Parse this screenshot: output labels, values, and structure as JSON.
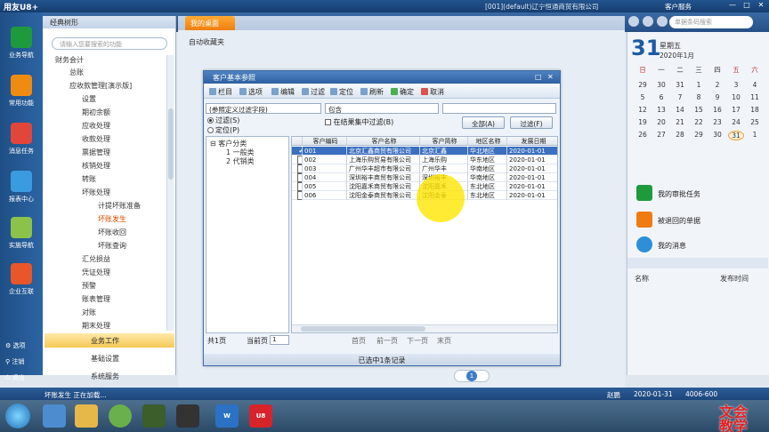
{
  "app": {
    "logo": "用友U8+",
    "account": "[001](default)辽宁恒通商贸有限公司",
    "service": "客户服务",
    "search_placeholder": "单据条码搜索",
    "min": "—",
    "restore": "□",
    "close": "✕"
  },
  "leftnav": [
    {
      "label": "业务导航",
      "color": "#1e9a3d"
    },
    {
      "label": "常用功能",
      "color": "#f08b12"
    },
    {
      "label": "消息任务",
      "color": "#e2463a"
    },
    {
      "label": "报表中心",
      "color": "#3b9be0"
    },
    {
      "label": "实施导航",
      "color": "#8bc34a"
    },
    {
      "label": "企业互联",
      "color": "#e8562a"
    }
  ],
  "leftbottom": [
    {
      "label": "选项"
    },
    {
      "label": "注销"
    },
    {
      "label": "退出"
    }
  ],
  "tree": {
    "header": "经典树形",
    "search_placeholder": "请输入您要搜索的功能",
    "items": [
      "财务会计",
      "总账",
      "应收款管理[演示版]",
      "设置",
      "期初余额",
      "应收处理",
      "收款处理",
      "票据管理",
      "核销处理",
      "转账",
      "坏账处理",
      "计提坏账准备",
      "坏账发生",
      "坏账收回",
      "坏账查询",
      "汇兑损益",
      "凭证处理",
      "预警",
      "账表管理",
      "对账",
      "期末处理"
    ],
    "tabs": [
      "业务工作",
      "基础设置",
      "系统服务"
    ]
  },
  "center": {
    "tab": "我的桌面",
    "favorites": "自动收藏夹"
  },
  "dialog": {
    "title": "客户基本参照",
    "toolbar": [
      "栏目",
      "选项",
      "编辑",
      "过滤",
      "定位",
      "刷新",
      "确定",
      "取消"
    ],
    "field": "(参照定义过滤字段)",
    "op": "包含",
    "radio1": "过滤(S)",
    "radio2": "定位(P)",
    "checkbox": "在结果集中过滤(B)",
    "btn_all": "全部(A)",
    "btn_filter": "过滤(F)",
    "tree": [
      "客户分类",
      "1 一般类",
      "2 代销类"
    ],
    "columns": [
      "客户编码",
      "客户名称",
      "客户简称",
      "地区名称",
      "发展日期"
    ],
    "rows": [
      [
        "001",
        "北京汇鑫商贸有限公司",
        "北京汇鑫",
        "华北地区",
        "2020-01-01"
      ],
      [
        "002",
        "上海乐购贸易有限公司",
        "上海乐购",
        "华东地区",
        "2020-01-01"
      ],
      [
        "003",
        "广州华丰超市有限公司",
        "广州华丰",
        "华南地区",
        "2020-01-01"
      ],
      [
        "004",
        "深圳裕丰商贸有限公司",
        "深圳裕丰",
        "华南地区",
        "2020-01-01"
      ],
      [
        "005",
        "沈阳嘉禾商贸有限公司",
        "沈阳嘉禾",
        "东北地区",
        "2020-01-01"
      ],
      [
        "006",
        "沈阳金泰商贸有限公司",
        "沈阳金泰",
        "东北地区",
        "2020-01-01"
      ]
    ],
    "check_mark": "✔",
    "pager": {
      "total": "共1页",
      "current_label": "当前页",
      "current": "1",
      "first": "首页",
      "prev": "前一页",
      "next": "下一页",
      "last": "末页"
    },
    "status": "已选中1条记录"
  },
  "calendar": {
    "day": "31",
    "weekday": "星期五",
    "month": "2020年1月",
    "headers": [
      "日",
      "一",
      "二",
      "三",
      "四",
      "五",
      "六"
    ],
    "weeks": [
      [
        "29",
        "30",
        "31",
        "1",
        "2",
        "3",
        "4"
      ],
      [
        "5",
        "6",
        "7",
        "8",
        "9",
        "10",
        "11"
      ],
      [
        "12",
        "13",
        "14",
        "15",
        "16",
        "17",
        "18"
      ],
      [
        "19",
        "20",
        "21",
        "22",
        "23",
        "24",
        "25"
      ],
      [
        "26",
        "27",
        "28",
        "29",
        "30",
        "31",
        "1"
      ]
    ]
  },
  "tasks": [
    {
      "label": "我的审批任务",
      "color": "#1e9a3d"
    },
    {
      "label": "被退回的单据",
      "color": "#f07b12"
    },
    {
      "label": "我的消息",
      "color": "#2e8fd8"
    }
  ],
  "msgcols": {
    "name": "名称",
    "time": "发布时间"
  },
  "pagenum": "1",
  "statusbar": {
    "left": "坏账发生 正在加载...",
    "user": "赵鹏",
    "date": "2020-01-31",
    "phone": "4006-600"
  },
  "watermark": [
    "文会",
    "教学"
  ]
}
